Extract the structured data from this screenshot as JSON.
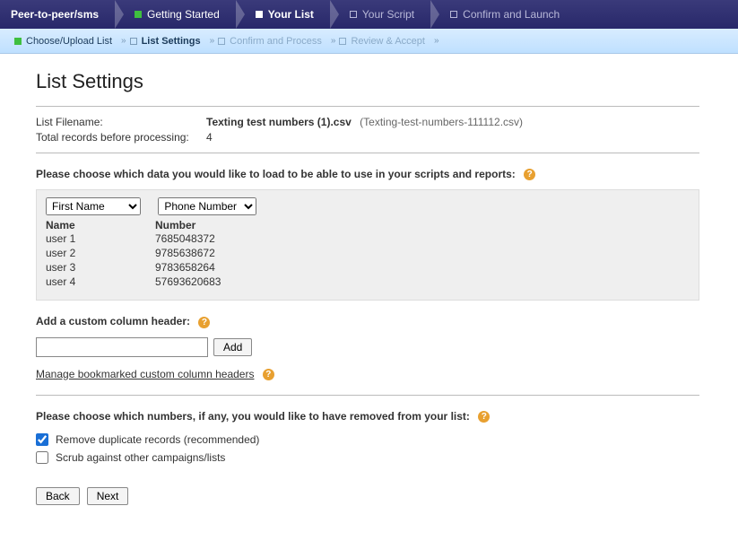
{
  "topnav": {
    "root": "Peer-to-peer/sms",
    "steps": [
      {
        "label": "Getting Started",
        "state": "done"
      },
      {
        "label": "Your List",
        "state": "current"
      },
      {
        "label": "Your Script",
        "state": "future"
      },
      {
        "label": "Confirm and Launch",
        "state": "future"
      }
    ]
  },
  "subnav": {
    "steps": [
      {
        "label": "Choose/Upload List",
        "state": "done"
      },
      {
        "label": "List Settings",
        "state": "current"
      },
      {
        "label": "Confirm and Process",
        "state": "future"
      },
      {
        "label": "Review & Accept",
        "state": "future"
      }
    ],
    "chev": "»"
  },
  "page": {
    "title": "List Settings",
    "meta": {
      "filename_label": "List Filename:",
      "filename_bold": "Texting test numbers (1).csv",
      "filename_sub": "(Texting-test-numbers-111112.csv)",
      "total_label": "Total records before processing:",
      "total_value": "4"
    },
    "columns_prompt": "Please choose which data you would like to load to be able to use in your scripts and reports:",
    "select1": {
      "value": "First Name",
      "options": [
        "First Name"
      ]
    },
    "select2": {
      "value": "Phone Number",
      "options": [
        "Phone Number"
      ]
    },
    "table": {
      "headers": [
        "Name",
        "Number"
      ],
      "rows": [
        {
          "name": "user 1",
          "number": "7685048372"
        },
        {
          "name": "user 2",
          "number": "9785638672"
        },
        {
          "name": "user 3",
          "number": "9783658264"
        },
        {
          "name": "user 4",
          "number": "57693620683"
        }
      ]
    },
    "custom": {
      "label": "Add a custom column header:",
      "input_value": "",
      "add_label": "Add",
      "manage_label": "Manage bookmarked custom column headers"
    },
    "remove_prompt": "Please choose which numbers, if any, you would like to have removed from your list:",
    "checks": {
      "dup": {
        "label": "Remove duplicate records (recommended)",
        "checked": true
      },
      "scrub": {
        "label": "Scrub against other campaigns/lists",
        "checked": false
      }
    },
    "buttons": {
      "back": "Back",
      "next": "Next"
    }
  }
}
